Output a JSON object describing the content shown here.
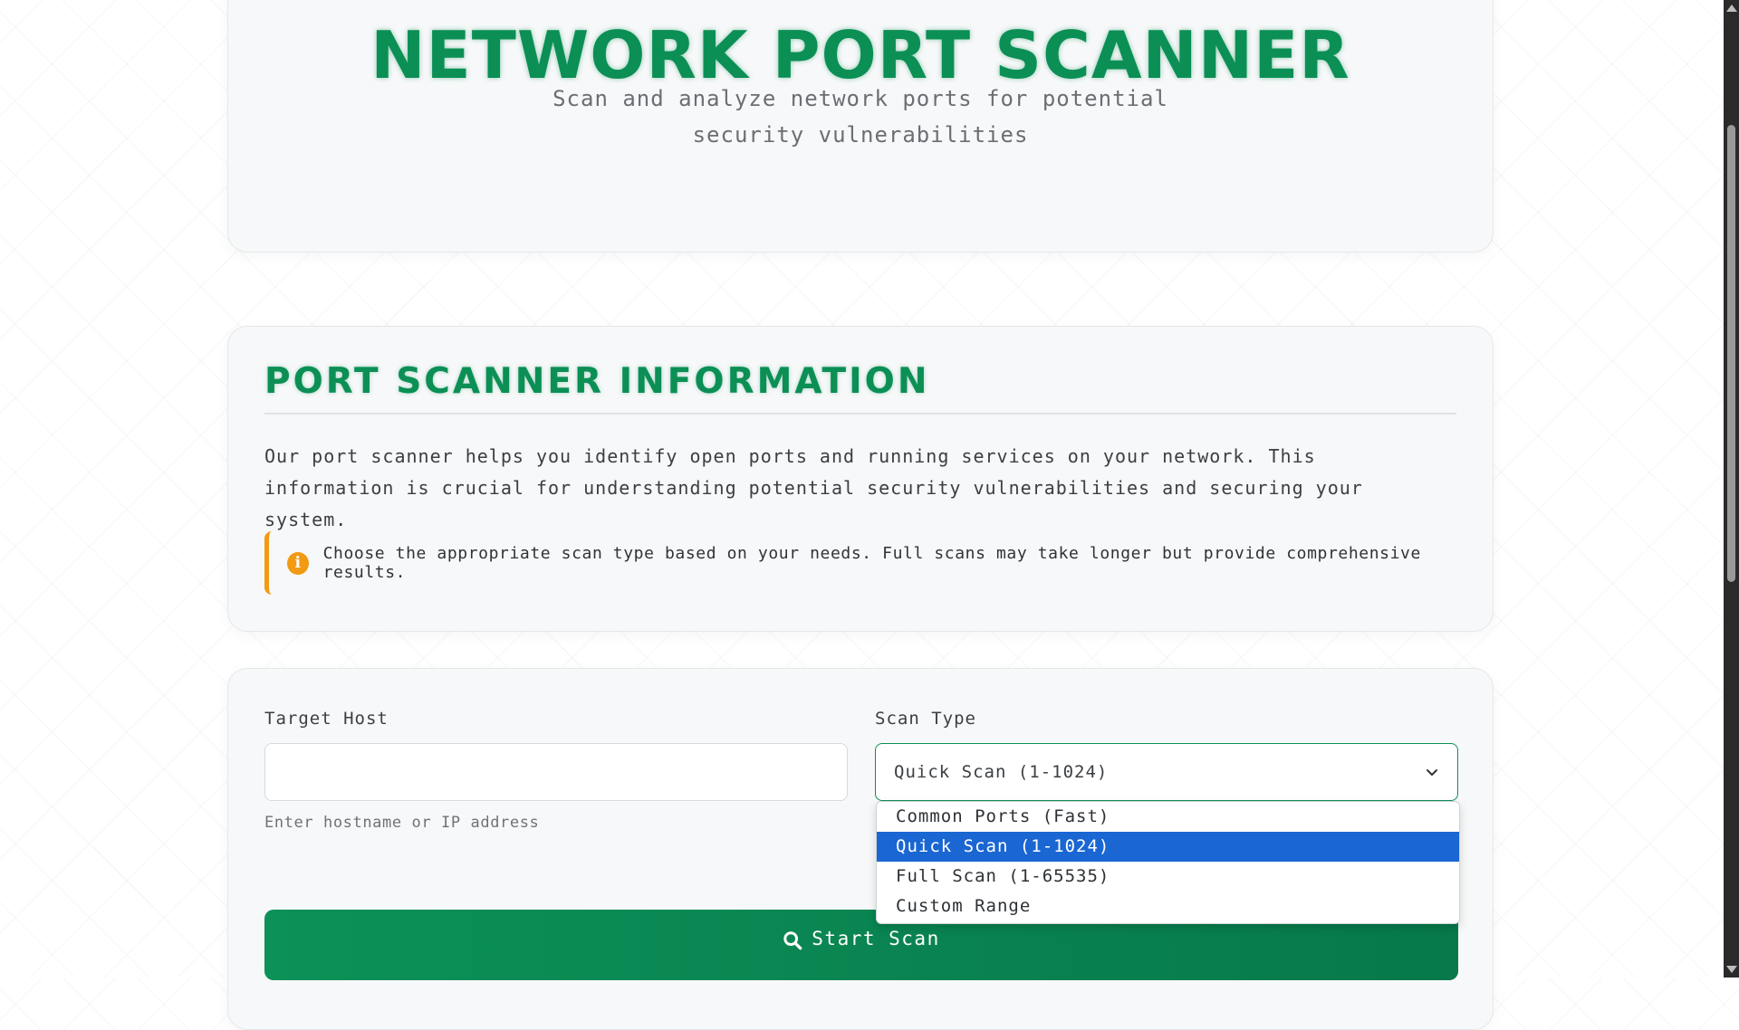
{
  "hero": {
    "title": "NETWORK PORT SCANNER",
    "subtitle": "Scan and analyze network ports for potential security vulnerabilities"
  },
  "info": {
    "heading": "PORT SCANNER INFORMATION",
    "description": "Our port scanner helps you identify open ports and running services on your network. This information is crucial for understanding potential security vulnerabilities and securing your system.",
    "notice_icon": "info-icon",
    "notice": "Choose the appropriate scan type based on your needs. Full scans may take longer but provide comprehensive results."
  },
  "form": {
    "target_label": "Target Host",
    "target_value": "",
    "target_hint": "Enter hostname or IP address",
    "scan_type_label": "Scan Type",
    "scan_type_selected": "Quick Scan (1-1024)",
    "scan_type_options": [
      "Common Ports (Fast)",
      "Quick Scan (1-1024)",
      "Full Scan (1-65535)",
      "Custom Range"
    ],
    "start_button": "Start Scan",
    "start_icon": "search-icon"
  },
  "colors": {
    "accent": "#0b8f55",
    "notice": "#f29a12",
    "selected_option": "#1a66d2"
  }
}
